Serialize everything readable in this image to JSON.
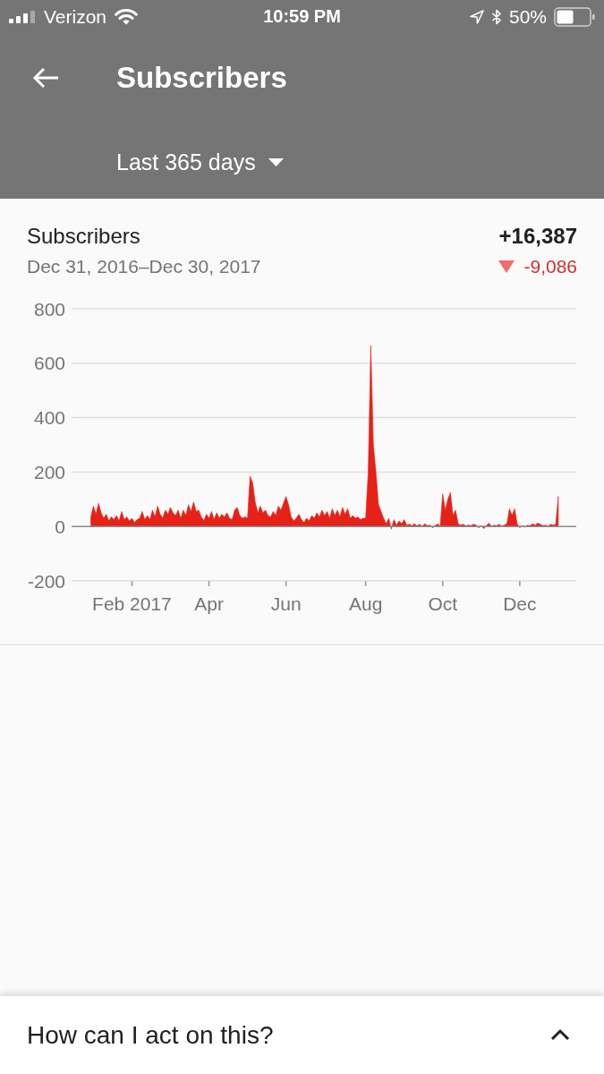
{
  "status_bar": {
    "carrier": "Verizon",
    "time": "10:59 PM",
    "battery": "50%"
  },
  "header": {
    "title": "Subscribers",
    "period_dropdown": {
      "value": "Last 365 days"
    }
  },
  "card": {
    "title": "Subscribers",
    "total": "+16,387",
    "date_range": "Dec 31, 2016–Dec 30, 2017",
    "change": {
      "negative": true,
      "value": "-9,086"
    },
    "chart_data": {
      "type": "area",
      "categories": [
        null,
        null,
        null,
        null,
        null,
        null,
        null,
        null,
        null,
        null,
        null,
        null,
        null,
        null,
        null,
        null,
        "Feb 2017",
        null,
        null,
        null,
        null,
        null,
        null,
        null,
        null,
        null,
        null,
        null,
        null,
        null,
        null,
        null,
        null,
        null,
        null,
        null,
        null,
        null,
        null,
        null,
        null,
        null,
        null,
        null,
        null,
        null,
        "Apr",
        null,
        null,
        null,
        null,
        null,
        null,
        null,
        null,
        null,
        null,
        null,
        null,
        null,
        null,
        null,
        null,
        null,
        null,
        null,
        null,
        null,
        null,
        null,
        null,
        null,
        null,
        null,
        null,
        null,
        "Jun",
        null,
        null,
        null,
        null,
        null,
        null,
        null,
        null,
        null,
        null,
        null,
        null,
        null,
        null,
        null,
        null,
        null,
        null,
        null,
        null,
        null,
        null,
        null,
        null,
        null,
        null,
        null,
        null,
        null,
        null,
        "Aug",
        null,
        null,
        null,
        null,
        null,
        null,
        null,
        null,
        null,
        null,
        null,
        null,
        null,
        null,
        null,
        null,
        null,
        null,
        null,
        null,
        null,
        null,
        null,
        null,
        null,
        null,
        null,
        null,
        null,
        "Oct",
        null,
        null,
        null,
        null,
        null,
        null,
        null,
        null,
        null,
        null,
        null,
        null,
        null,
        null,
        null,
        null,
        null,
        null,
        null,
        null,
        null,
        null,
        null,
        null,
        null,
        null,
        null,
        null,
        null,
        "Dec",
        null,
        null,
        null,
        null,
        null,
        null,
        null,
        null,
        null,
        null,
        null,
        null,
        null,
        null,
        null
      ],
      "series": [
        {
          "color": "#e62117",
          "values": [
            35,
            75,
            45,
            85,
            50,
            30,
            45,
            20,
            35,
            25,
            40,
            20,
            55,
            25,
            35,
            20,
            30,
            15,
            25,
            30,
            55,
            25,
            40,
            25,
            60,
            35,
            75,
            45,
            30,
            60,
            45,
            70,
            50,
            40,
            60,
            30,
            60,
            40,
            80,
            55,
            90,
            55,
            60,
            35,
            20,
            45,
            30,
            55,
            25,
            50,
            30,
            45,
            35,
            50,
            30,
            25,
            60,
            70,
            40,
            30,
            35,
            30,
            185,
            160,
            90,
            50,
            75,
            50,
            60,
            40,
            35,
            55,
            40,
            75,
            60,
            85,
            110,
            80,
            35,
            20,
            30,
            45,
            25,
            15,
            30,
            20,
            40,
            30,
            50,
            35,
            60,
            40,
            55,
            30,
            65,
            40,
            60,
            35,
            70,
            45,
            65,
            30,
            40,
            30,
            35,
            25,
            30,
            30,
            200,
            665,
            300,
            200,
            80,
            55,
            30,
            10,
            30,
            -10,
            25,
            5,
            20,
            10,
            25,
            5,
            8,
            3,
            10,
            2,
            8,
            0,
            10,
            3,
            5,
            -5,
            2,
            10,
            0,
            120,
            60,
            100,
            125,
            40,
            60,
            10,
            5,
            8,
            2,
            5,
            3,
            8,
            5,
            -5,
            2,
            -8,
            3,
            12,
            0,
            5,
            2,
            8,
            0,
            5,
            10,
            65,
            40,
            65,
            10,
            -5,
            3,
            -3,
            5,
            2,
            10,
            5,
            12,
            8,
            3,
            5,
            0,
            8,
            5,
            8,
            110
          ]
        }
      ],
      "ylim": [
        -200,
        800
      ],
      "yticks": [
        -200,
        0,
        200,
        400,
        600,
        800
      ],
      "grid": true
    }
  },
  "bottom_sheet": {
    "title": "How can I act on this?",
    "expanded": false
  }
}
